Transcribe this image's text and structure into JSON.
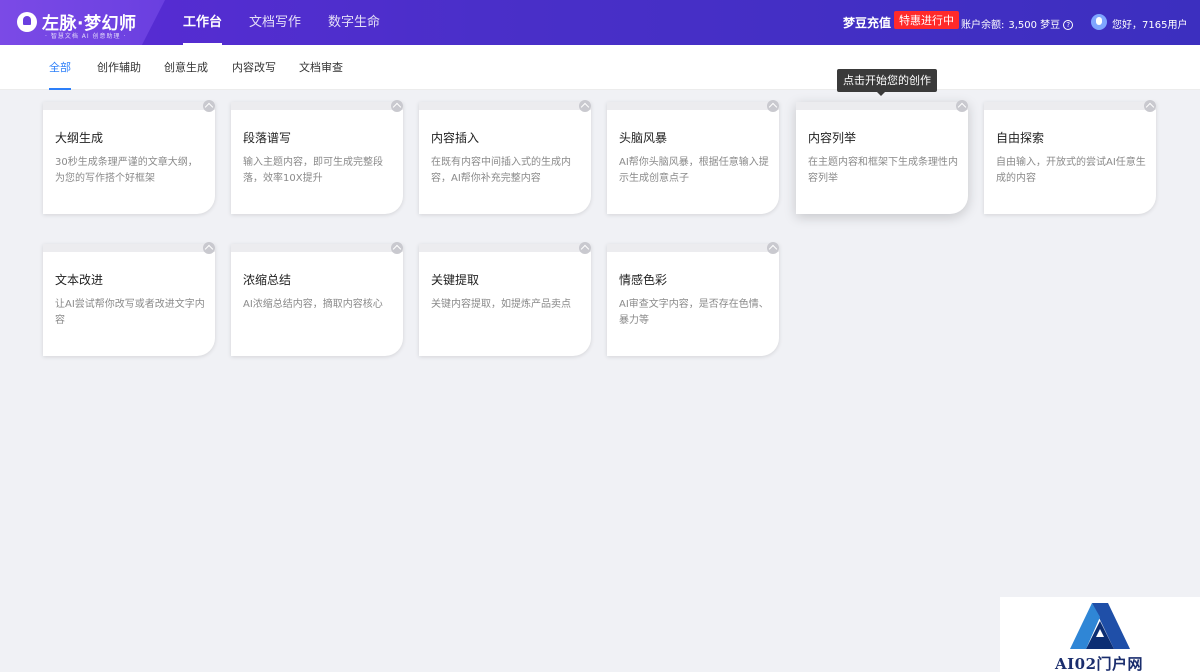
{
  "header": {
    "logo_title": "左脉·梦幻师",
    "logo_subtitle": "· 智慧文档 AI 创意助理 ·",
    "nav": [
      "工作台",
      "文档写作",
      "数字生命"
    ],
    "recharge_label": "梦豆充值",
    "promo_badge": "特惠进行中",
    "balance_label": "账户余额:",
    "balance_amount": "3,500 梦豆",
    "greeting": "您好，7165用户"
  },
  "subnav": {
    "tabs": [
      "全部",
      "创作辅助",
      "创意生成",
      "内容改写",
      "文档审查"
    ],
    "active_index": 0
  },
  "tooltip": "点击开始您的创作",
  "cards": [
    {
      "title": "大纲生成",
      "desc": "30秒生成条理严谨的文章大纲，为您的写作搭个好框架"
    },
    {
      "title": "段落谱写",
      "desc": "输入主题内容，即可生成完整段落，效率10X提升"
    },
    {
      "title": "内容插入",
      "desc": "在既有内容中间插入式的生成内容，AI帮你补充完整内容"
    },
    {
      "title": "头脑风暴",
      "desc": "AI帮你头脑风暴，根据任意输入提示生成创意点子"
    },
    {
      "title": "内容列举",
      "desc": "在主题内容和框架下生成条理性内容列举"
    },
    {
      "title": "自由探索",
      "desc": "自由输入，开放式的尝试AI任意生成的内容"
    },
    {
      "title": "文本改进",
      "desc": "让AI尝试帮你改写或者改进文字内容"
    },
    {
      "title": "浓缩总结",
      "desc": "AI浓缩总结内容，摘取内容核心"
    },
    {
      "title": "关键提取",
      "desc": "关键内容提取，如提炼产品卖点"
    },
    {
      "title": "情感色彩",
      "desc": "AI审查文字内容，是否存在色情、暴力等"
    }
  ],
  "watermark": "AI02门户网",
  "colors": {
    "header_gradient_start": "#5b2bd6",
    "accent_blue": "#2d7ff9",
    "promo_red": "#ff2a2a"
  }
}
